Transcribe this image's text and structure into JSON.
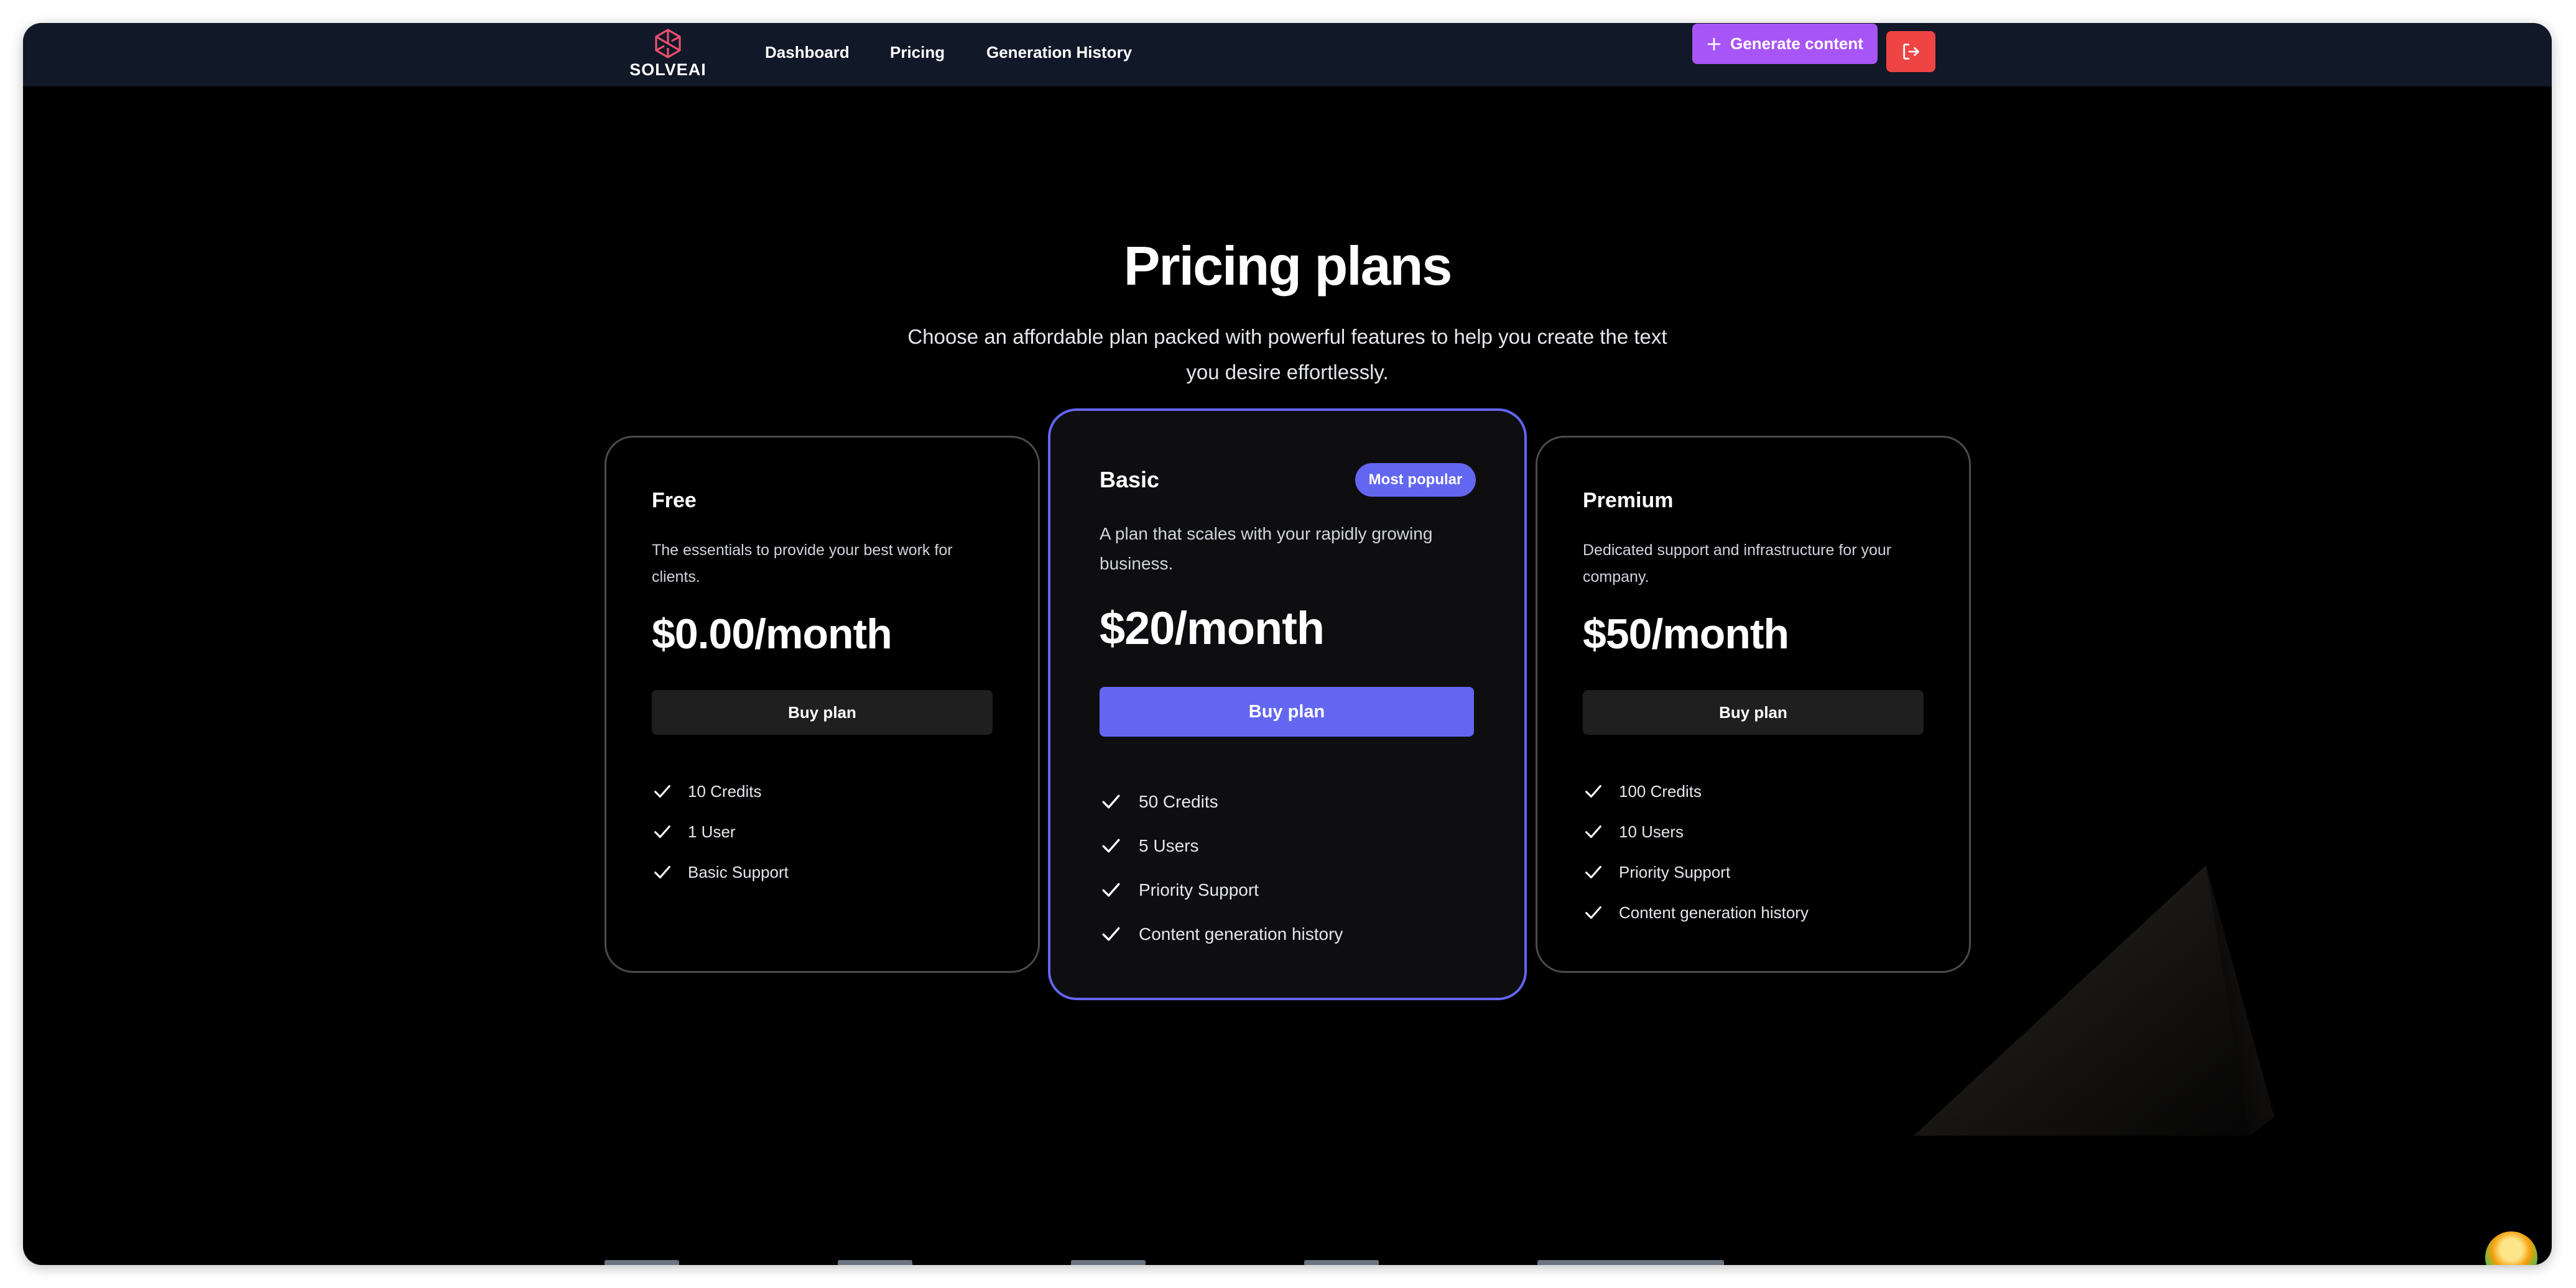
{
  "header": {
    "logo_text": "SOLVEAI",
    "nav": [
      {
        "label": "Dashboard"
      },
      {
        "label": "Pricing"
      },
      {
        "label": "Generation History"
      }
    ],
    "generate_label": "Generate content",
    "generate_icon": "plus-icon",
    "logout_icon": "logout-icon",
    "colors": {
      "header_bg": "#111827",
      "generate_bg": "#a855f7",
      "logout_bg": "#ef4444"
    }
  },
  "hero": {
    "title": "Pricing plans",
    "subtitle": "Choose an affordable plan packed with powerful features to help you create the text you desire effortlessly."
  },
  "plans": [
    {
      "name": "Free",
      "description": "The essentials to provide your best work for clients.",
      "price": "$0.00/month",
      "button": "Buy plan",
      "features": [
        "10 Credits",
        "1 User",
        "Basic Support"
      ]
    },
    {
      "name": "Basic",
      "badge": "Most popular",
      "description": "A plan that scales with your rapidly growing business.",
      "price": "$20/month",
      "button": "Buy plan",
      "features": [
        "50 Credits",
        "5 Users",
        "Priority Support",
        "Content generation history"
      ]
    },
    {
      "name": "Premium",
      "description": "Dedicated support and infrastructure for your company.",
      "price": "$50/month",
      "button": "Buy plan",
      "features": [
        "100 Credits",
        "10 Users",
        "Priority Support",
        "Content generation history"
      ]
    }
  ],
  "theme": {
    "background": "#000000",
    "accent": "#6366f1"
  }
}
